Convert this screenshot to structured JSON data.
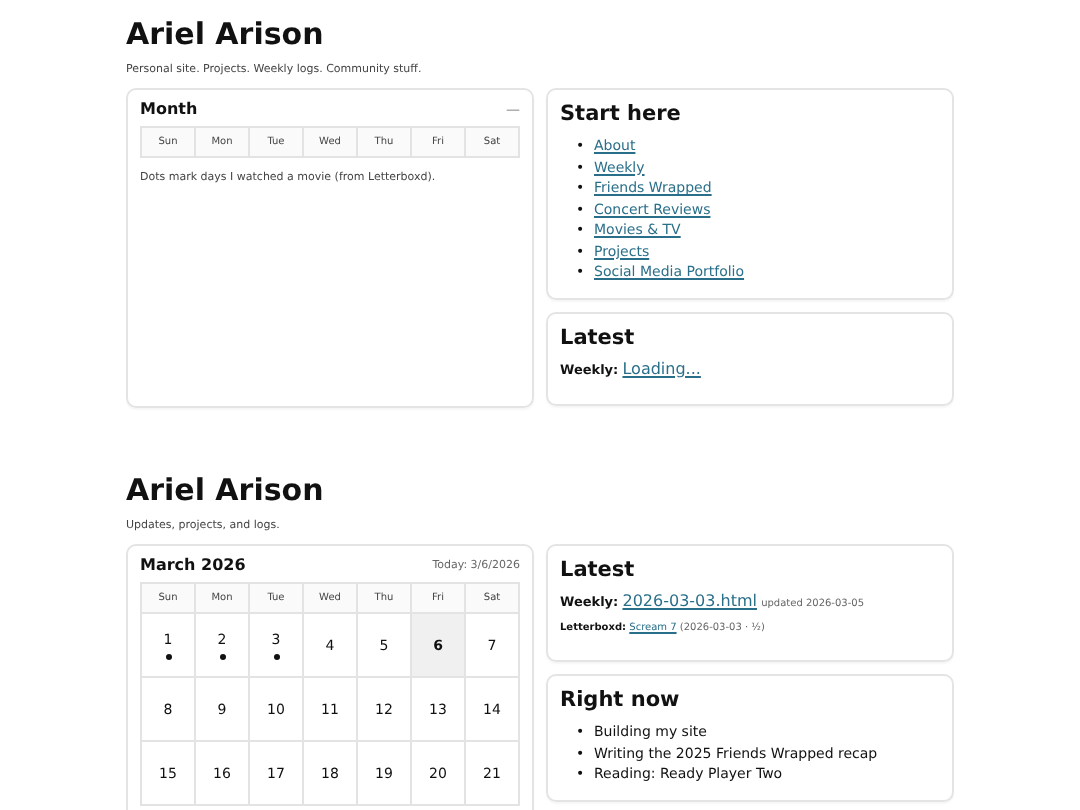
{
  "section_1": {
    "title": "Ariel Arison",
    "subtitle": "Personal site. Projects. Weekly logs. Community stuff.",
    "month_card": {
      "title": "Month",
      "collapse_glyph": "—",
      "weekdays": [
        "Sun",
        "Mon",
        "Tue",
        "Wed",
        "Thu",
        "Fri",
        "Sat"
      ],
      "note": "Dots mark days I watched a movie (from Letterboxd)."
    },
    "start_here": {
      "title": "Start here",
      "marker": "•",
      "links": [
        "About",
        "Weekly",
        "Friends Wrapped",
        "Concert Reviews",
        "Movies & TV",
        "Projects",
        "Social Media Portfolio"
      ]
    },
    "latest": {
      "title": "Latest",
      "rows": [
        {
          "kind": "main",
          "label": "Weekly:",
          "link": "Loading..."
        }
      ]
    }
  },
  "section_2": {
    "title": "Ariel Arison",
    "subtitle": "Updates, projects, and logs.",
    "calendar": {
      "title": "March 2026",
      "today_label": "Today: 3/6/2026",
      "weekdays": [
        "Sun",
        "Mon",
        "Tue",
        "Wed",
        "Thu",
        "Fri",
        "Sat"
      ],
      "days": [
        {
          "day": "1",
          "dot": true,
          "today": false
        },
        {
          "day": "2",
          "dot": true,
          "today": false
        },
        {
          "day": "3",
          "dot": true,
          "today": false
        },
        {
          "day": "4",
          "dot": false,
          "today": false
        },
        {
          "day": "5",
          "dot": false,
          "today": false
        },
        {
          "day": "6",
          "dot": false,
          "today": true
        },
        {
          "day": "7",
          "dot": false,
          "today": false
        },
        {
          "day": "8",
          "dot": false,
          "today": false
        },
        {
          "day": "9",
          "dot": false,
          "today": false
        },
        {
          "day": "10",
          "dot": false,
          "today": false
        },
        {
          "day": "11",
          "dot": false,
          "today": false
        },
        {
          "day": "12",
          "dot": false,
          "today": false
        },
        {
          "day": "13",
          "dot": false,
          "today": false
        },
        {
          "day": "14",
          "dot": false,
          "today": false
        },
        {
          "day": "15",
          "dot": false,
          "today": false
        },
        {
          "day": "16",
          "dot": false,
          "today": false
        },
        {
          "day": "17",
          "dot": false,
          "today": false
        },
        {
          "day": "18",
          "dot": false,
          "today": false
        },
        {
          "day": "19",
          "dot": false,
          "today": false
        },
        {
          "day": "20",
          "dot": false,
          "today": false
        },
        {
          "day": "21",
          "dot": false,
          "today": false
        }
      ]
    },
    "latest": {
      "title": "Latest",
      "rows": [
        {
          "kind": "main",
          "label": "Weekly:",
          "link": "2026-03-03.html",
          "note": "updated 2026-03-05"
        },
        {
          "kind": "small",
          "label": "Letterboxd:",
          "link": "Scream 7",
          "note": "(2026-03-03 · ½)"
        }
      ]
    },
    "right_now": {
      "title": "Right now",
      "marker": "•",
      "items": [
        "Building my site",
        "Writing the 2025 Friends Wrapped recap",
        "Reading: Ready Player Two"
      ]
    }
  }
}
